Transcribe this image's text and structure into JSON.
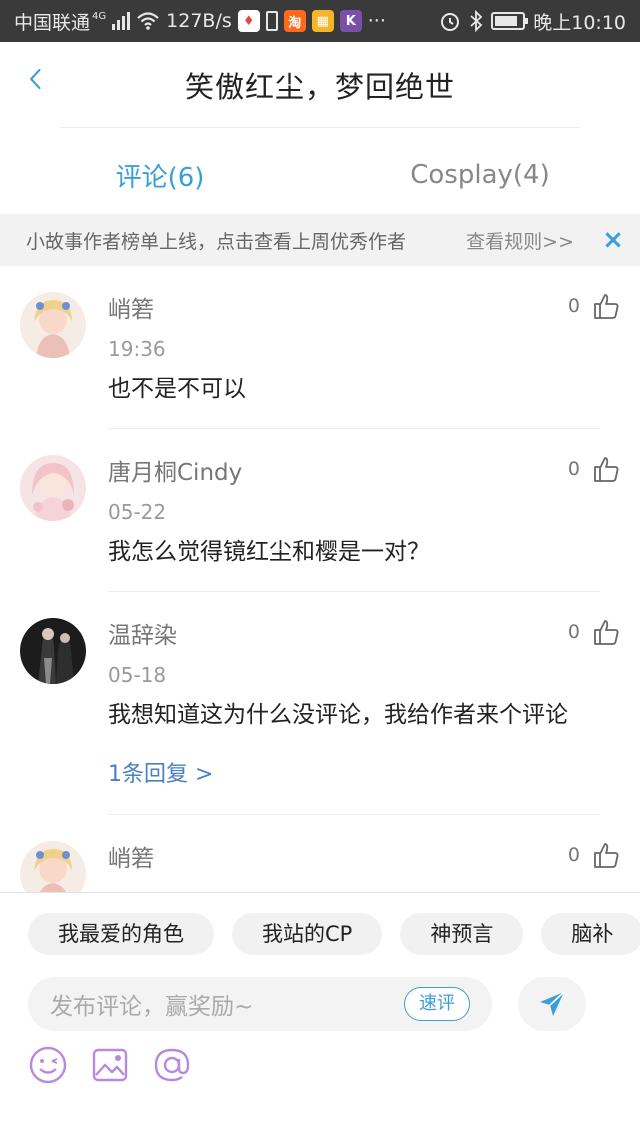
{
  "status_bar": {
    "carrier": "中国联通",
    "network": "4G",
    "speed": "127B/s",
    "dots": "···",
    "time": "晚上10:10",
    "icons": [
      "signal-icon",
      "wifi-icon",
      "app-notification-icon",
      "sim-icon",
      "taobao-icon",
      "app-icon",
      "k-app-icon",
      "alarm-icon",
      "bluetooth-icon",
      "battery-icon"
    ]
  },
  "header": {
    "title": "笑傲红尘，梦回绝世",
    "back_icon": "chevron-left-icon"
  },
  "tabs": [
    {
      "label": "评论(6)",
      "active": true
    },
    {
      "label": "Cosplay(4)",
      "active": false
    }
  ],
  "notice": {
    "text": "小故事作者榜单上线，点击查看上周优秀作者",
    "link": "查看规则>>",
    "close": "×"
  },
  "comments": [
    {
      "name": "峭箬",
      "time": "19:36",
      "content": "也不是不可以",
      "likes": "0",
      "reply": ""
    },
    {
      "name": "唐月桐Cindy",
      "time": "05-22",
      "content": "我怎么觉得镜红尘和樱是一对？",
      "likes": "0",
      "reply": ""
    },
    {
      "name": "温辞染",
      "time": "05-18",
      "content": "我想知道这为什么没评论，我给作者来个评论",
      "likes": "0",
      "reply": "1条回复 >"
    },
    {
      "name": "峭箬",
      "time": "",
      "content": "",
      "likes": "0",
      "reply": ""
    }
  ],
  "bottom": {
    "chips": [
      "我最爱的角色",
      "我站的CP",
      "神预言",
      "脑补"
    ],
    "input_placeholder": "发布评论，赢奖励~",
    "quick_label": "速评",
    "tool_icons": [
      "emoji-icon",
      "image-icon",
      "at-icon"
    ]
  },
  "colors": {
    "accent": "#3a9fd8",
    "link": "#4a7fc0",
    "tool_purple": "#b78ae0"
  }
}
